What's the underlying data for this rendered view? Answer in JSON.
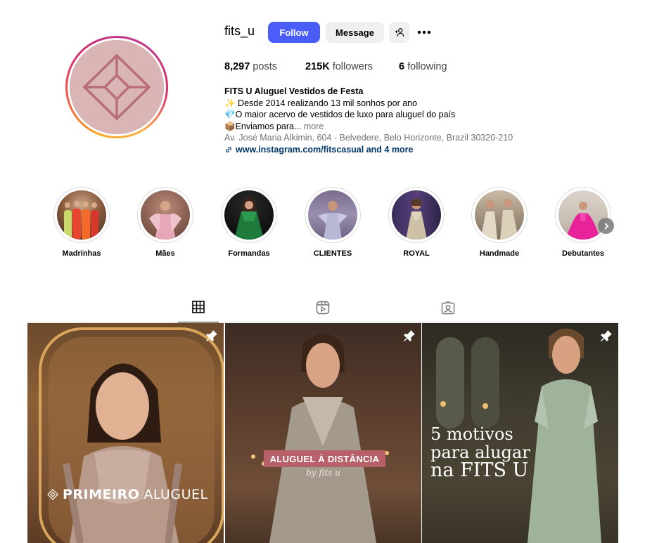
{
  "profile": {
    "username": "fits_u",
    "follow_label": "Follow",
    "message_label": "Message",
    "posts_count": "8,297",
    "posts_label": "posts",
    "followers_count": "215K",
    "followers_label": "followers",
    "following_count": "6",
    "following_label": "following"
  },
  "bio": {
    "name": "FITS U Aluguel Vestidos de Festa",
    "line1": "✨ Desde 2014 realizando 13 mil sonhos por ano",
    "line2": "💎O maior acervo de vestidos de luxo para aluguel do país",
    "line3": "📦Enviamos para...",
    "more": "more",
    "address": "Av. José Maria Alkimin, 604 - Belvedere, Belo Horizonte, Brazil 30320-210",
    "link": "www.instagram.com/fitscasual and 4 more"
  },
  "highlights": [
    {
      "label": "Madrinhas"
    },
    {
      "label": "Mães"
    },
    {
      "label": "Formandas"
    },
    {
      "label": "CLIENTES"
    },
    {
      "label": "ROYAL"
    },
    {
      "label": "Handmade"
    },
    {
      "label": "Debutantes"
    }
  ],
  "tabs": {
    "active": "posts",
    "icons": [
      "grid-icon",
      "reels-icon",
      "tagged-icon"
    ]
  },
  "posts": [
    {
      "text_bold": "PRIMEIRO",
      "text_light": "ALUGUEL",
      "pinned": true
    },
    {
      "banner": "ALUGUEL À DISTÂNCIA",
      "sub": "by fits u",
      "pinned": true
    },
    {
      "line1": "5 motivos",
      "line2": "para alugar",
      "line3": "na FITS U",
      "pinned": true
    }
  ],
  "colors": {
    "follow_button": "#4a5df9",
    "secondary_button": "#efefef",
    "link": "#00376b",
    "muted_text": "#737373"
  }
}
